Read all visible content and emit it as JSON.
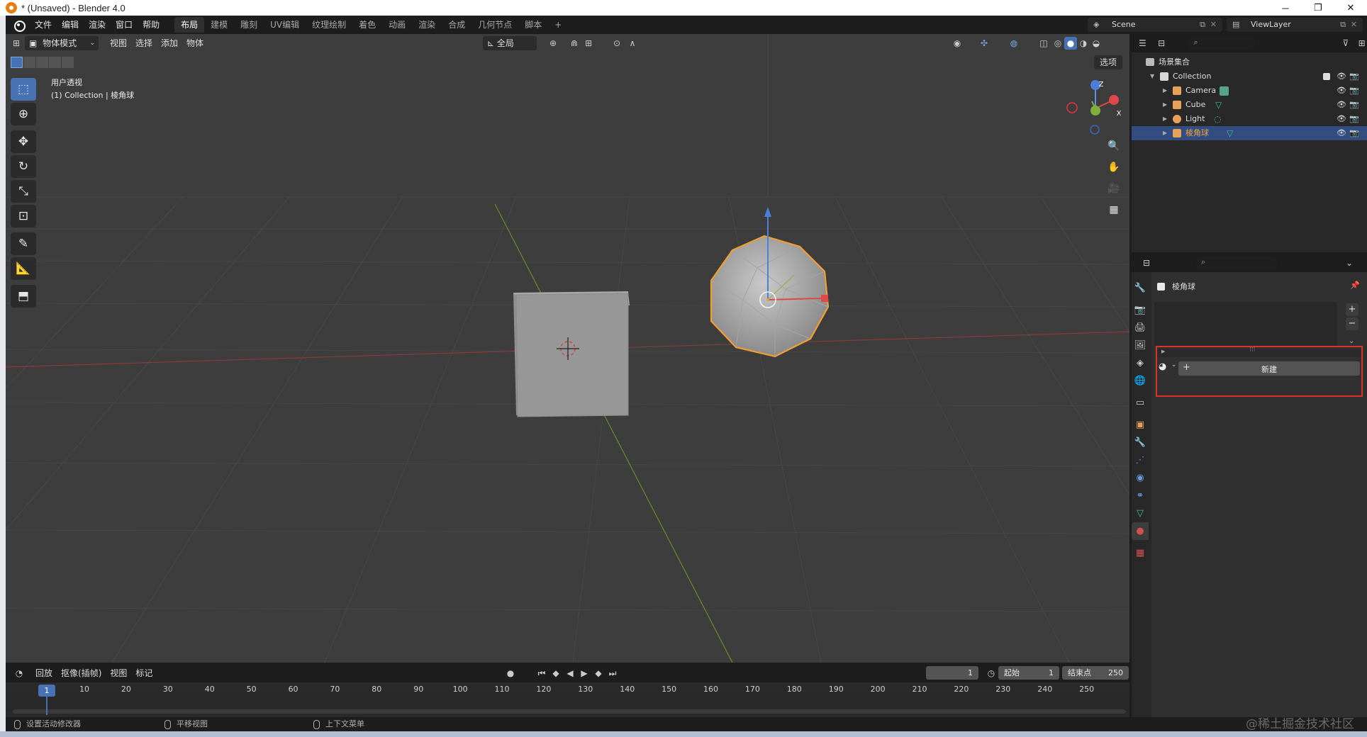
{
  "window": {
    "title": "* (Unsaved) - Blender 4.0",
    "min": "─",
    "max": "❐",
    "close": "✕"
  },
  "menu": [
    "文件",
    "编辑",
    "渲染",
    "窗口",
    "帮助"
  ],
  "workspaces": [
    "布局",
    "建模",
    "雕刻",
    "UV编辑",
    "纹理绘制",
    "着色",
    "动画",
    "渲染",
    "合成",
    "几何节点",
    "脚本"
  ],
  "workspace_add": "+",
  "scene": "Scene",
  "view_layer": "ViewLayer",
  "viewport": {
    "mode": "物体模式",
    "menus": [
      "视图",
      "选择",
      "添加",
      "物体"
    ],
    "transform_orientation": "全局",
    "options": "选项",
    "info_line1": "用户透视",
    "info_line2": "(1) Collection | 棱角球",
    "gizmo": {
      "x": "X",
      "y": "Y",
      "z": "Z"
    }
  },
  "outliner": {
    "scene_collection": "场景集合",
    "items": [
      {
        "name": "Collection",
        "color": "#cccccc"
      },
      {
        "name": "Camera",
        "color": "#e8a05a"
      },
      {
        "name": "Cube",
        "color": "#e8a05a"
      },
      {
        "name": "Light",
        "color": "#e8a05a"
      },
      {
        "name": "棱角球",
        "color": "#e8a05a"
      }
    ]
  },
  "properties": {
    "object_name": "棱角球",
    "new_button": "新建",
    "add": "+",
    "remove": "−"
  },
  "timeline": {
    "menus": [
      "回放",
      "抠像(插帧)",
      "视图",
      "标记"
    ],
    "current_frame": "1",
    "start_label": "起始",
    "start_value": "1",
    "end_label": "结束点",
    "end_value": "250",
    "ticks": [
      "1",
      "10",
      "20",
      "30",
      "40",
      "50",
      "60",
      "70",
      "80",
      "90",
      "100",
      "110",
      "120",
      "130",
      "140",
      "150",
      "160",
      "170",
      "180",
      "190",
      "200",
      "210",
      "220",
      "230",
      "240",
      "250"
    ]
  },
  "status": {
    "left": "设置活动修改器",
    "middle": "平移视图",
    "right": "上下文菜单"
  },
  "watermark": "@稀土掘金技术社区",
  "colors": {
    "accent": "#4772b3",
    "selected_outline": "#e8a033",
    "highlight_box": "#e0302a"
  }
}
